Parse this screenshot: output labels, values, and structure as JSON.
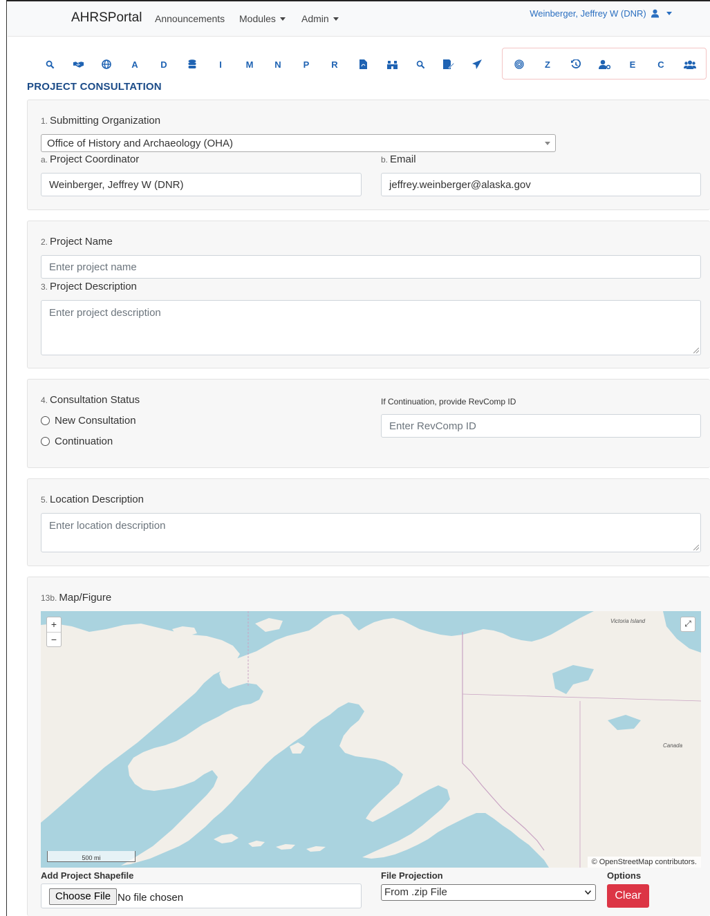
{
  "navbar": {
    "brand": "AHRSPortal",
    "links": [
      {
        "label": "Announcements"
      },
      {
        "label": "Modules"
      },
      {
        "label": "Admin"
      }
    ],
    "user": "Weinberger, Jeffrey W (DNR)"
  },
  "toolbar": {
    "letters": [
      "A",
      "D",
      "I",
      "M",
      "N",
      "P",
      "R",
      "Z",
      "E",
      "C"
    ]
  },
  "page": {
    "title": "PROJECT CONSULTATION"
  },
  "org_section": {
    "num": "1.",
    "label": "Submitting Organization",
    "selected": "Office of History and Archaeology (OHA)",
    "coordinator_num": "a.",
    "coordinator_label": "Project Coordinator",
    "coordinator_value": "Weinberger, Jeffrey W (DNR)",
    "email_num": "b.",
    "email_label": "Email",
    "email_value": "jeffrey.weinberger@alaska.gov"
  },
  "project_section": {
    "name_num": "2.",
    "name_label": "Project Name",
    "name_placeholder": "Enter project name",
    "desc_num": "3.",
    "desc_label": "Project Description",
    "desc_placeholder": "Enter project description"
  },
  "status_section": {
    "num": "4.",
    "label": "Consultation Status",
    "options": [
      "New Consultation",
      "Continuation"
    ],
    "revcomp_label": "If Continuation, provide RevComp ID",
    "revcomp_placeholder": "Enter RevComp ID"
  },
  "location_section": {
    "num": "5.",
    "label": "Location Description",
    "placeholder": "Enter location description"
  },
  "map_section": {
    "num": "13b.",
    "label": "Map/Figure",
    "zoom_in": "+",
    "zoom_out": "−",
    "scale": "500 mi",
    "attribution": "© OpenStreetMap contributors.",
    "places": [
      "Victoria Island",
      "Canada"
    ],
    "colors": {
      "water": "#aad3df",
      "land": "#f2efe9",
      "border": "#c9a3c3"
    }
  },
  "upload": {
    "shapefile_label": "Add Project Shapefile",
    "choose_file": "Choose File",
    "no_file": "No file chosen",
    "projection_label": "File Projection",
    "projection_value": "From .zip File",
    "options_label": "Options",
    "clear": "Clear",
    "clear_color": "#dc3545"
  }
}
